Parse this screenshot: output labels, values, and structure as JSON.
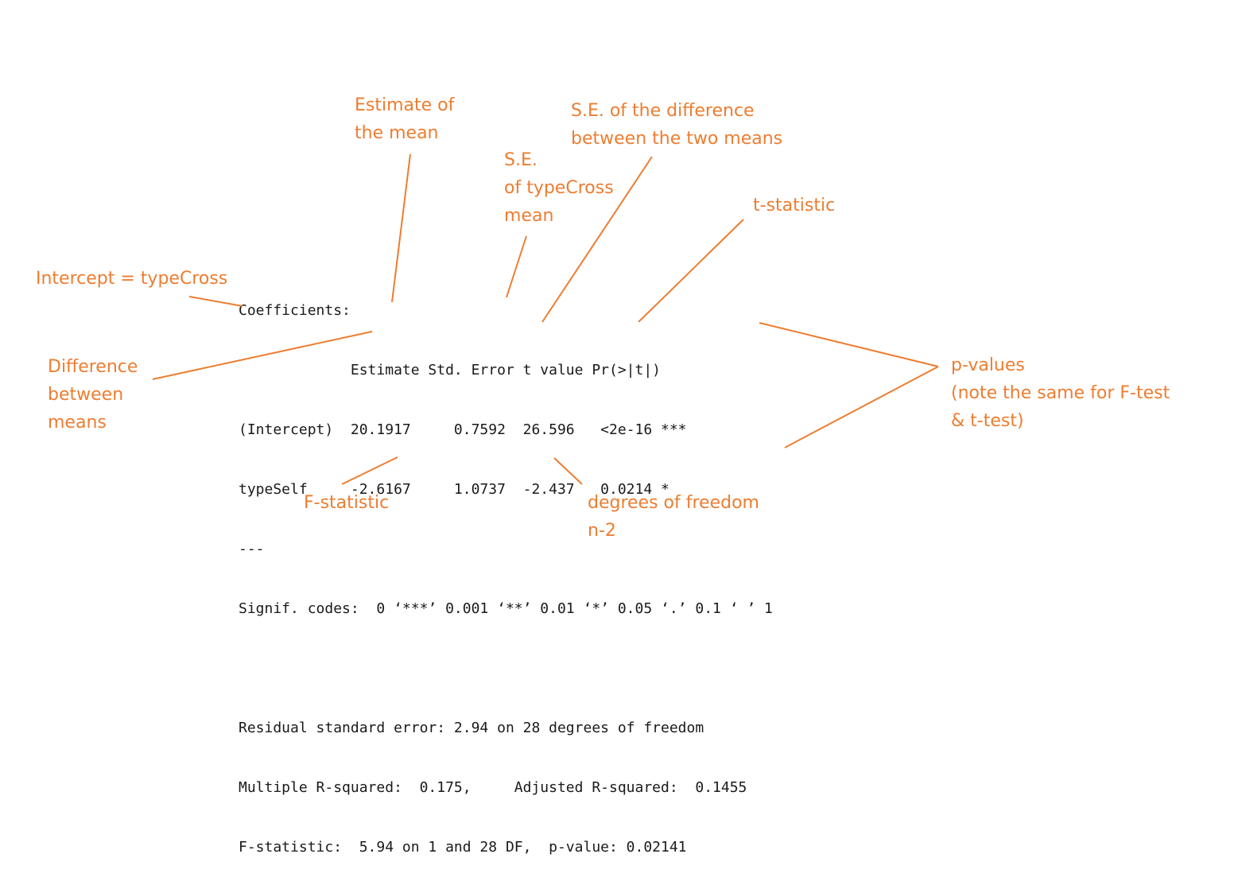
{
  "console": {
    "lines": [
      "Coefficients:",
      "             Estimate Std. Error t value Pr(>|t|)",
      "(Intercept)  20.1917     0.7592  26.596   <2e-16 ***",
      "typeSelf     -2.6167     1.0737  -2.437   0.0214 *",
      "---",
      "Signif. codes:  0 ‘***’ 0.001 ‘**’ 0.01 ‘*’ 0.05 ‘.’ 0.1 ‘ ’ 1",
      "",
      "Residual standard error: 2.94 on 28 degrees of freedom",
      "Multiple R-squared:  0.175,     Adjusted R-squared:  0.1455",
      "F-statistic:  5.94 on 1 and 28 DF,  p-value: 0.02141"
    ]
  },
  "annotations": {
    "estimate_mean": [
      "Estimate of",
      "the mean"
    ],
    "se_typecross": [
      "S.E.",
      "of typeCross",
      "mean"
    ],
    "se_difference": [
      "S.E. of the difference",
      "between the two means"
    ],
    "t_statistic": [
      "t-statistic"
    ],
    "intercept": [
      "Intercept = typeCross"
    ],
    "difference_means": [
      "Difference",
      "between",
      "means"
    ],
    "p_values": [
      "p-values",
      "(note the same for F-test",
      "& t-test)"
    ],
    "f_statistic": [
      "F-statistic"
    ],
    "degrees_freedom": [
      "degrees of freedom",
      "n-2"
    ]
  },
  "colors": {
    "annotation": "#ed7d31",
    "console_text": "#1a1a1a",
    "background": "#ffffff"
  }
}
